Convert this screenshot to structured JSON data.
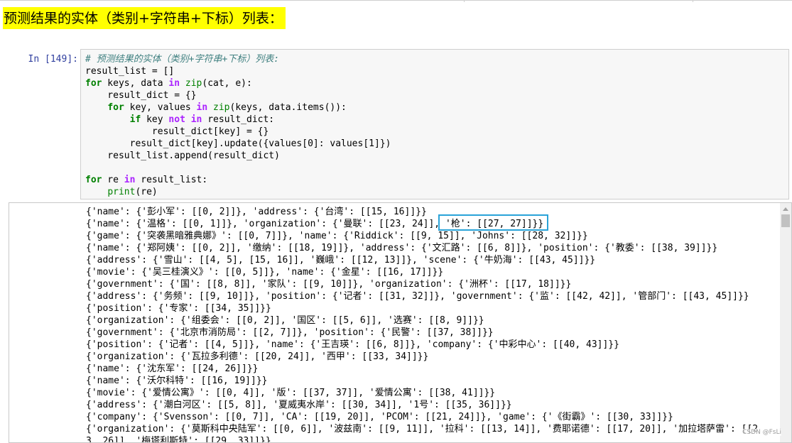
{
  "heading": "预测结果的实体（类别+字符串+下标）列表：",
  "cell": {
    "prompt": "In [149]:",
    "code": {
      "comment": "# 预测结果的实体（类别+字符串+下标）列表:",
      "l2_a": "result_list = []",
      "l3_for": "for",
      "l3_a": " keys, data ",
      "l3_in": "in",
      "l3_sp": " ",
      "l3_zip": "zip",
      "l3_b": "(cat, e):",
      "l4": "    result_dict = {}",
      "l5_ind": "    ",
      "l5_for": "for",
      "l5_a": " key, values ",
      "l5_in": "in",
      "l5_sp": " ",
      "l5_zip": "zip",
      "l5_b": "(keys, data.items()):",
      "l6_ind": "        ",
      "l6_if": "if",
      "l6_a": " key ",
      "l6_not": "not",
      "l6_sp": " ",
      "l6_in": "in",
      "l6_b": " result_dict:",
      "l7": "            result_dict[key] = {}",
      "l8": "        result_dict[key].update({values[0]: values[1]})",
      "l9": "    result_list.append(result_dict)",
      "l11_for": "for",
      "l11_a": " re ",
      "l11_in": "in",
      "l11_b": " result_list:",
      "l12_ind": "    ",
      "l12_print": "print",
      "l12_b": "(re)"
    }
  },
  "output": {
    "lines": [
      "{'name': {'彭小军': [[0, 2]]}, 'address': {'台湾': [[15, 16]]}}",
      "{'name': {'温格': [[0, 1]]}, 'organization': {'曼联': [[23, 24]], '枪': [[27, 27]]}}",
      "{'game': {'突袭黑暗雅典娜》': [[0, 7]]}, 'name': {'Riddick': [[9, 15]], 'Johns': [[28, 32]]}}",
      "{'name': {'郑阿姨': [[0, 2]], '缴纳': [[18, 19]]}, 'address': {'文汇路': [[6, 8]]}, 'position': {'教委': [[38, 39]]}}",
      "{'address': {'雪山': [[4, 5], [15, 16]], '巍峨': [[12, 13]]}, 'scene': {'牛奶海': [[43, 45]]}}",
      "{'movie': {'吴三桂演义》': [[0, 5]]}, 'name': {'金星': [[16, 17]]}}",
      "{'government': {'国': [[8, 8]], '家队': [[9, 10]]}, 'organization': {'洲杯': [[17, 18]]}}",
      "{'address': {'务频': [[9, 10]]}, 'position': {'记者': [[31, 32]]}, 'government': {'监': [[42, 42]], '管部门': [[43, 45]]}}",
      "{'position': {'专家': [[34, 35]]}}",
      "{'organization': {'组委会': [[0, 2]], '国区': [[5, 6]], '选赛': [[8, 9]]}}",
      "{'government': {'北京市消防局': [[2, 7]]}, 'position': {'民警': [[37, 38]]}}",
      "{'position': {'记者': [[4, 5]]}, 'name': {'王吉瑛': [[6, 8]]}, 'company': {'中彩中心': [[40, 43]]}}",
      "{'organization': {'瓦拉多利德': [[20, 24]], '西甲': [[33, 34]]}}",
      "{'name': {'沈东军': [[24, 26]]}}",
      "{'name': {'沃尔科特': [[16, 19]]}}",
      "{'movie': {'爱情公寓》': [[0, 4]], '版': [[37, 37]], '爱情公寓': [[38, 41]]}}",
      "{'address': {'潮白河区': [[5, 8]], '夏威夷水岸': [[30, 34]], '1号': [[35, 36]]}}",
      "{'company': {'Svensson': [[0, 7]], 'CA': [[19, 20]], 'PCOM': [[21, 24]]}, 'game': {'《街霸》': [[30, 33]]}}",
      "{'organization': {'莫斯科中央陆军': [[0, 6]], '波兹南': [[9, 11]], '拉科': [[13, 14]], '费耶诺德': [[17, 20]], '加拉塔萨雷': [[2",
      "3, 26]], '梅塔利斯特': [[29, 33]]}}"
    ],
    "watermark": "CSDN @FsLi"
  }
}
